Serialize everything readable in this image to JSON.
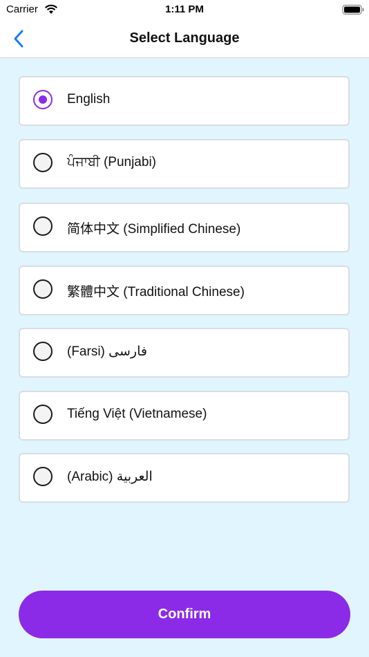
{
  "status_bar": {
    "carrier": "Carrier",
    "time": "1:11 PM"
  },
  "nav": {
    "title": "Select Language",
    "back_icon": "chevron-left-icon"
  },
  "languages": [
    {
      "label": "English",
      "selected": true
    },
    {
      "label": "ਪੰਜਾਬੀ (Punjabi)",
      "selected": false
    },
    {
      "label": "简体中文 (Simplified Chinese)",
      "selected": false
    },
    {
      "label": "繁體中文 (Traditional Chinese)",
      "selected": false
    },
    {
      "label": "(Farsi) فارسی",
      "selected": false
    },
    {
      "label": "Tiếng Việt (Vietnamese)",
      "selected": false
    },
    {
      "label": "(Arabic) العربية",
      "selected": false
    }
  ],
  "confirm": {
    "label": "Confirm"
  },
  "colors": {
    "accent": "#8b2be8",
    "background": "#e0f5fd",
    "back_arrow": "#1a7cf5"
  }
}
